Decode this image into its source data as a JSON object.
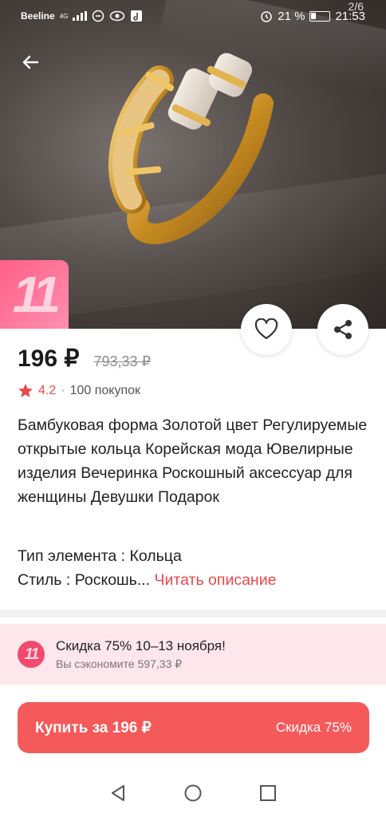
{
  "status_bar": {
    "carrier": "Beeline",
    "network": "4G",
    "battery": "21 %",
    "time": "21:53"
  },
  "gallery": {
    "counter": "2/6",
    "promo_badge": "11"
  },
  "product": {
    "price": "196 ₽",
    "old_price": "793,33 ₽",
    "rating": "4.2",
    "separator": "·",
    "sales": "100 покупок",
    "title": "Бамбуковая форма Золотой цвет Регулируемые открытые кольца Корейская мода Ювелирные изделия Вечеринка Роскошный аксессуар для женщины Девушки Подарок",
    "spec_type": "Тип элемента : Кольца",
    "spec_style": "Стиль : Роскошь...",
    "read_more": "Читать описание"
  },
  "sale_banner": {
    "icon_text": "11",
    "title": "Скидка 75% 10–13 ноября!",
    "subtitle": "Вы сэкономите 597,33 ₽"
  },
  "buy_button": {
    "label": "Купить за 196 ₽",
    "discount": "Скидка 75%"
  },
  "colors": {
    "accent": "#f45a5a",
    "rating": "#e94949",
    "banner_bg": "#fde6ec"
  }
}
